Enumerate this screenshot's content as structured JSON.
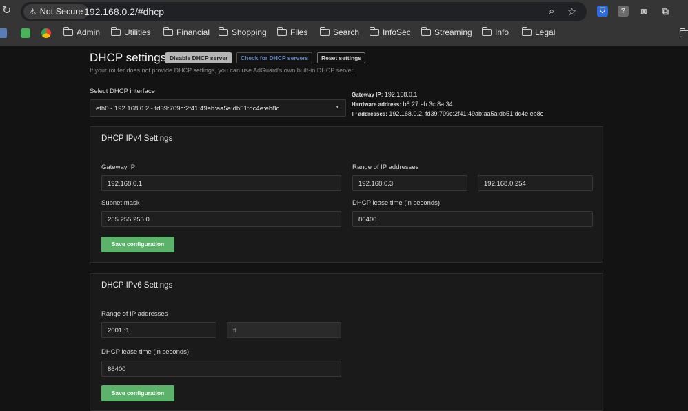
{
  "browser": {
    "security_label": "Not Secure",
    "url": "192.168.0.2/#dhcp",
    "bookmarks": [
      "Admin",
      "Utilities",
      "Financial",
      "Shopping",
      "Files",
      "Search",
      "InfoSec",
      "Streaming",
      "Info",
      "Legal"
    ]
  },
  "header": {
    "title": "DHCP settings",
    "disable_btn": "Disable DHCP server",
    "check_btn": "Check for DHCP servers",
    "reset_btn": "Reset settings",
    "subtitle": "If your router does not provide DHCP settings, you can use AdGuard's own built-in DHCP server."
  },
  "interface": {
    "label": "Select DHCP interface",
    "selected": "eth0 - 192.168.0.2 - fd39:709c:2f41:49ab:aa5a:db51:dc4e:eb8c",
    "gateway_label": "Gateway IP:",
    "gateway_value": "192.168.0.1",
    "hw_label": "Hardware address:",
    "hw_value": "b8:27:eb:3c:8a:34",
    "ip_label": "IP addresses:",
    "ip_value": "192.168.0.2, fd39:709c:2f41:49ab:aa5a:db51:dc4e:eb8c"
  },
  "ipv4": {
    "title": "DHCP IPv4 Settings",
    "gateway_label": "Gateway IP",
    "gateway_value": "192.168.0.1",
    "range_label": "Range of IP addresses",
    "range_start": "192.168.0.3",
    "range_end": "192.168.0.254",
    "subnet_label": "Subnet mask",
    "subnet_value": "255.255.255.0",
    "lease_label": "DHCP lease time (in seconds)",
    "lease_value": "86400",
    "save_btn": "Save configuration"
  },
  "ipv6": {
    "title": "DHCP IPv6 Settings",
    "range_label": "Range of IP addresses",
    "range_start": "2001::1",
    "range_end": "ff",
    "lease_label": "DHCP lease time (in seconds)",
    "lease_value": "86400",
    "save_btn": "Save configuration"
  }
}
